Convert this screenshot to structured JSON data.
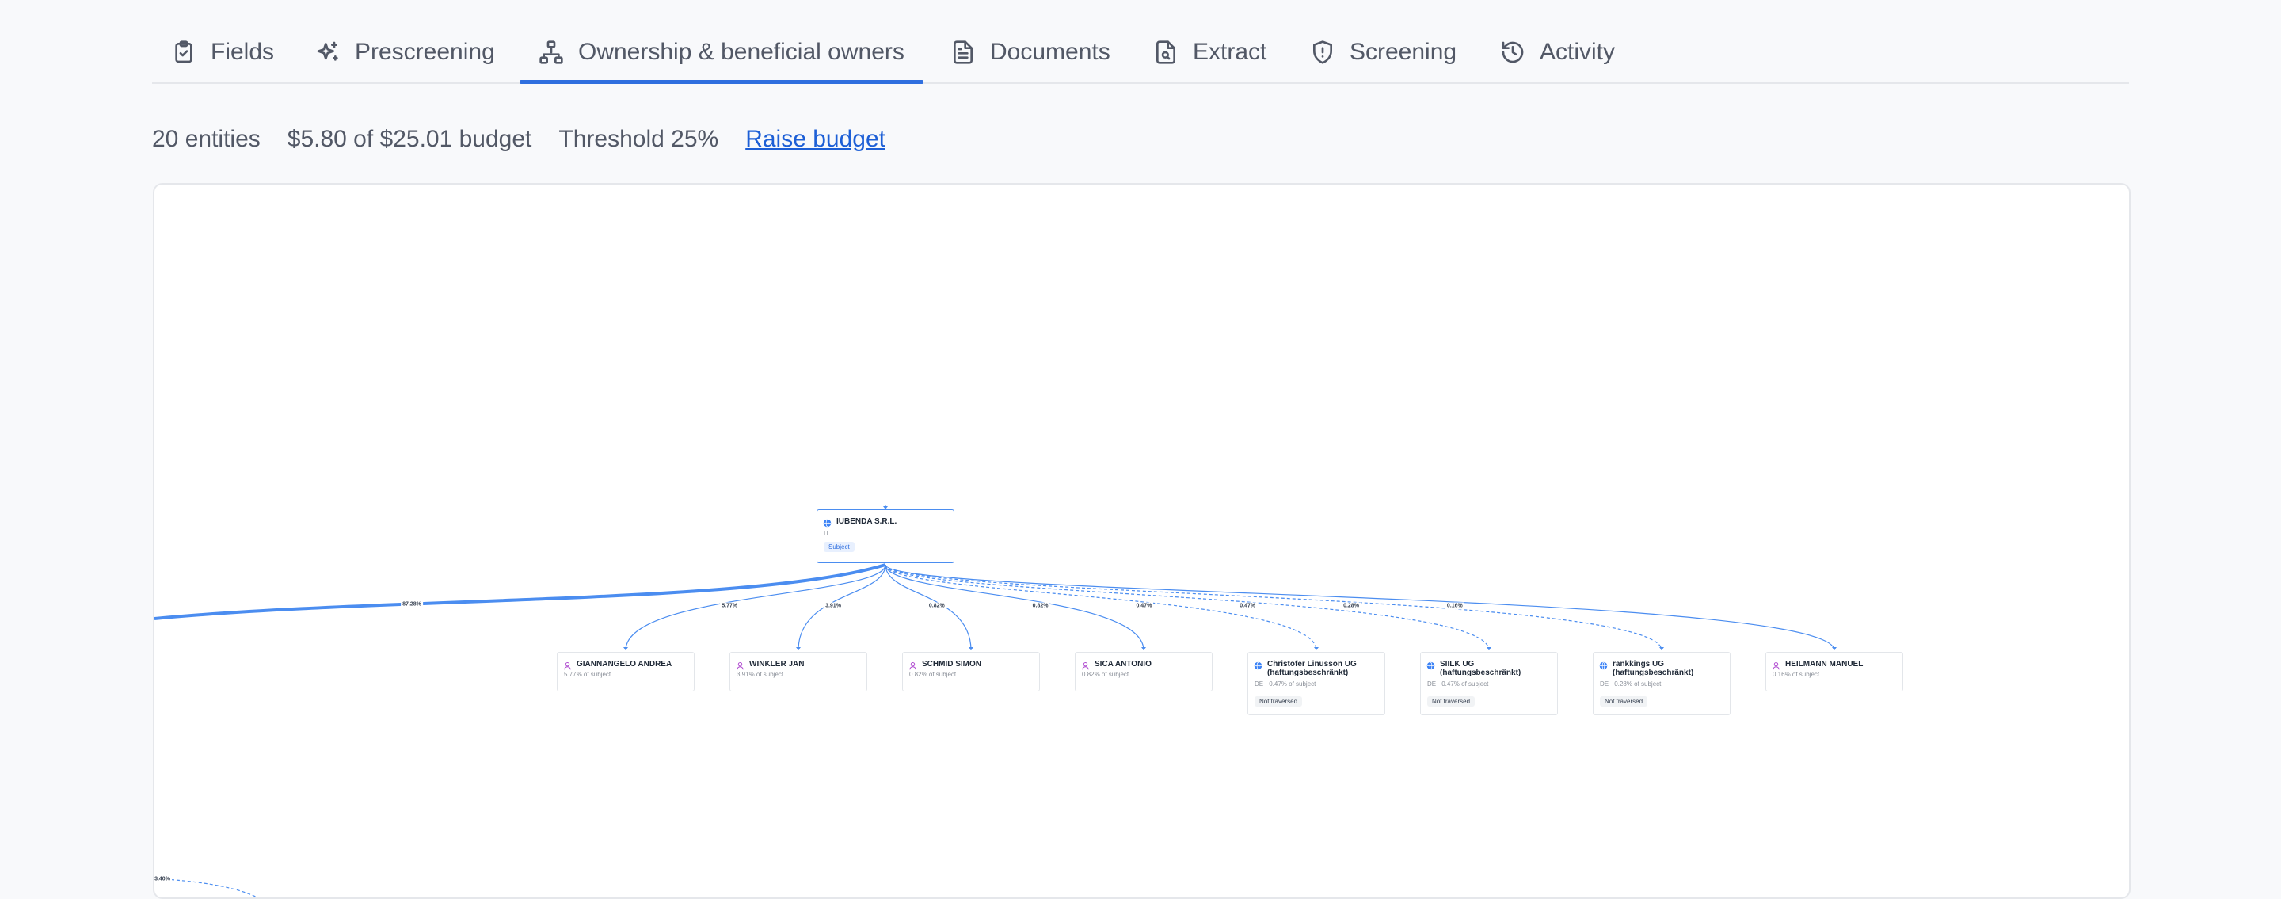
{
  "tabs": [
    {
      "label": "Fields",
      "icon": "clipboard-check-icon"
    },
    {
      "label": "Prescreening",
      "icon": "sparkles-icon"
    },
    {
      "label": "Ownership & beneficial owners",
      "icon": "org-chart-icon",
      "active": true
    },
    {
      "label": "Documents",
      "icon": "document-icon"
    },
    {
      "label": "Extract",
      "icon": "file-search-icon"
    },
    {
      "label": "Screening",
      "icon": "shield-icon"
    },
    {
      "label": "Activity",
      "icon": "history-icon"
    }
  ],
  "stats": {
    "entities": "20 entities",
    "budget": "$5.80 of $25.01 budget",
    "threshold": "Threshold 25%",
    "raise_budget": "Raise budget"
  },
  "graph": {
    "subject": {
      "name": "IUBENDA S.R.L.",
      "country": "IT",
      "badge": "Subject"
    },
    "offscreen_edge_label": "87.28%",
    "bottom_edge_label": "3.40%",
    "children": [
      {
        "name": "GIANNANGELO ANDREA",
        "type": "person",
        "detail": "5.77% of subject",
        "edge": "5.77%"
      },
      {
        "name": "WINKLER JAN",
        "type": "person",
        "detail": "3.91% of subject",
        "edge": "3.91%"
      },
      {
        "name": "SCHMID SIMON",
        "type": "person",
        "detail": "0.82% of subject",
        "edge": "0.82%"
      },
      {
        "name": "SICA ANTONIO",
        "type": "person",
        "detail": "0.82% of subject",
        "edge": "0.82%"
      },
      {
        "name": "Christofer Linusson UG (haftungsbeschränkt)",
        "type": "company",
        "detail": "DE · 0.47% of subject",
        "badge": "Not traversed",
        "edge": "0.47%"
      },
      {
        "name": "SIILK UG (haftungsbeschränkt)",
        "type": "company",
        "detail": "DE · 0.47% of subject",
        "badge": "Not traversed",
        "edge": "0.47%"
      },
      {
        "name": "rankkings UG (haftungsbeschränkt)",
        "type": "company",
        "detail": "DE · 0.28% of subject",
        "badge": "Not traversed",
        "edge": "0.28%"
      },
      {
        "name": "HEILMANN MANUEL",
        "type": "person",
        "detail": "0.16% of subject",
        "edge": "0.16%"
      }
    ]
  },
  "colors": {
    "accent": "#2f6fdf",
    "edge": "#4b8df0",
    "person_icon": "#b04ad0",
    "company_icon": "#3b82f6"
  }
}
